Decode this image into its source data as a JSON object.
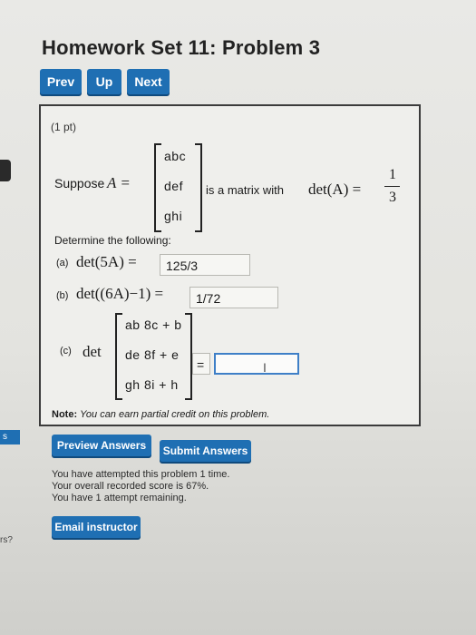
{
  "header": {
    "title": "Homework Set 11: Problem 3"
  },
  "nav": {
    "prev": "Prev",
    "up": "Up",
    "next": "Next"
  },
  "problem": {
    "points": "(1 pt)",
    "suppose": "Suppose",
    "A_eq": "A =",
    "matrix_A": [
      "abc",
      "def",
      "ghi"
    ],
    "is_matrix_with": "is a matrix with",
    "det_A_eq": "det(A) =",
    "frac_num": "1",
    "frac_den": "3",
    "determine": "Determine the following:",
    "part_a_label": "(a)",
    "part_a_expr": "det(5A) =",
    "part_a_value": "125/3",
    "part_b_label": "(b)",
    "part_b_expr": "det((6A)−1) =",
    "part_b_value": "1/72",
    "part_c_label": "(c)",
    "part_c_det": "det",
    "matrix_C": [
      "ab 8c + b",
      "de 8f + e",
      "gh 8i + h"
    ],
    "part_c_eq": "=",
    "part_c_value": ""
  },
  "note": {
    "label": "Note:",
    "text": "You can earn partial credit on this problem."
  },
  "actions": {
    "preview": "Preview Answers",
    "submit": "Submit Answers"
  },
  "status": {
    "line1": "You have attempted this problem 1 time.",
    "line2": "Your overall recorded score is 67%.",
    "line3": "You have 1 attempt remaining."
  },
  "email": {
    "label": "Email instructor"
  },
  "edge": {
    "left_tab": "s",
    "left_text": "rs?"
  },
  "colors": {
    "button_blue": "#1f6fb3",
    "input_focus": "#3e7fc7"
  }
}
